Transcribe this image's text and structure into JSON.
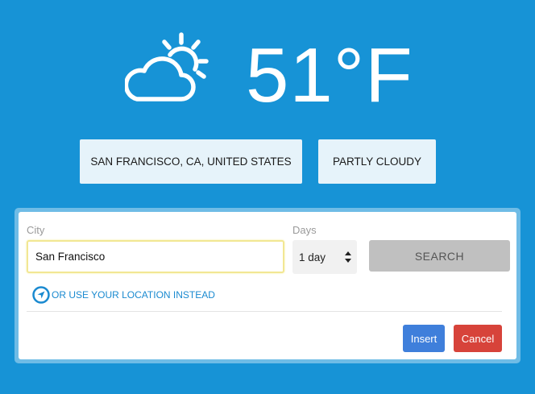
{
  "weather": {
    "icon": "partly-cloudy-icon",
    "temperature": "51°F",
    "location": "SAN FRANCISCO, CA, UNITED STATES",
    "condition": "PARTLY CLOUDY"
  },
  "form": {
    "city_label": "City",
    "city_value": "San Francisco",
    "days_label": "Days",
    "days_value": "1 day",
    "search_label": "SEARCH",
    "location_link": "OR USE YOUR LOCATION INSTEAD",
    "location_icon": "location-arrow-icon",
    "insert_label": "Insert",
    "cancel_label": "Cancel"
  },
  "colors": {
    "background": "#1793d6",
    "insert": "#3f7fdb",
    "cancel": "#d7433a",
    "link": "#1a8ad0"
  }
}
